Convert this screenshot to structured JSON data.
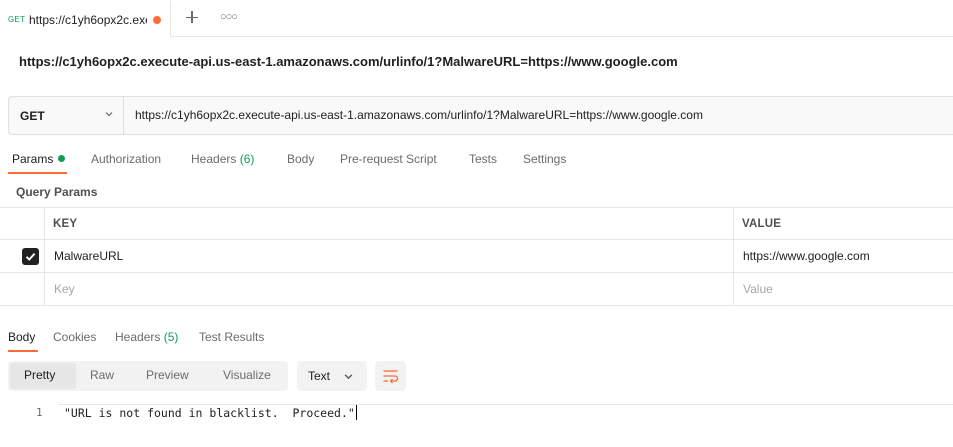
{
  "tab": {
    "method": "GET",
    "title": "https://c1yh6opx2c.execute-api.us-east-1.amazonaws.com/urlinfo/1?MalwareURL=https://www.google.com",
    "unsaved_indicator_color": "#ff6c37",
    "new_tab_icon": "plus-icon",
    "more_icon": "ellipsis-icon"
  },
  "request": {
    "name": "https://c1yh6opx2c.execute-api.us-east-1.amazonaws.com/urlinfo/1?MalwareURL=https://www.google.com",
    "method": "GET",
    "url": "https://c1yh6opx2c.execute-api.us-east-1.amazonaws.com/urlinfo/1?MalwareURL=https://www.google.com"
  },
  "request_tabs": {
    "params": "Params",
    "authorization": "Authorization",
    "headers": "Headers",
    "headers_count": "(6)",
    "body": "Body",
    "prerequest": "Pre-request Script",
    "tests": "Tests",
    "settings": "Settings",
    "active": "Params"
  },
  "query_params": {
    "title": "Query Params",
    "columns": {
      "key": "KEY",
      "value": "VALUE"
    },
    "rows": [
      {
        "checked": true,
        "key": "MalwareURL",
        "value": "https://www.google.com"
      }
    ],
    "placeholder": {
      "key": "Key",
      "value": "Value"
    }
  },
  "response_tabs": {
    "body": "Body",
    "cookies": "Cookies",
    "headers": "Headers",
    "headers_count": "(5)",
    "test_results": "Test Results",
    "active": "Body"
  },
  "response_toolbar": {
    "views": [
      "Pretty",
      "Raw",
      "Preview",
      "Visualize"
    ],
    "active_view": "Pretty",
    "format": "Text",
    "wrap_icon": "wrap-lines-icon"
  },
  "response_body": {
    "lines": [
      {
        "number": "1",
        "text": "\"URL is not found in blacklist.  Proceed.\""
      }
    ]
  },
  "colors": {
    "accent": "#ff6c37",
    "success": "#0f9d58"
  }
}
